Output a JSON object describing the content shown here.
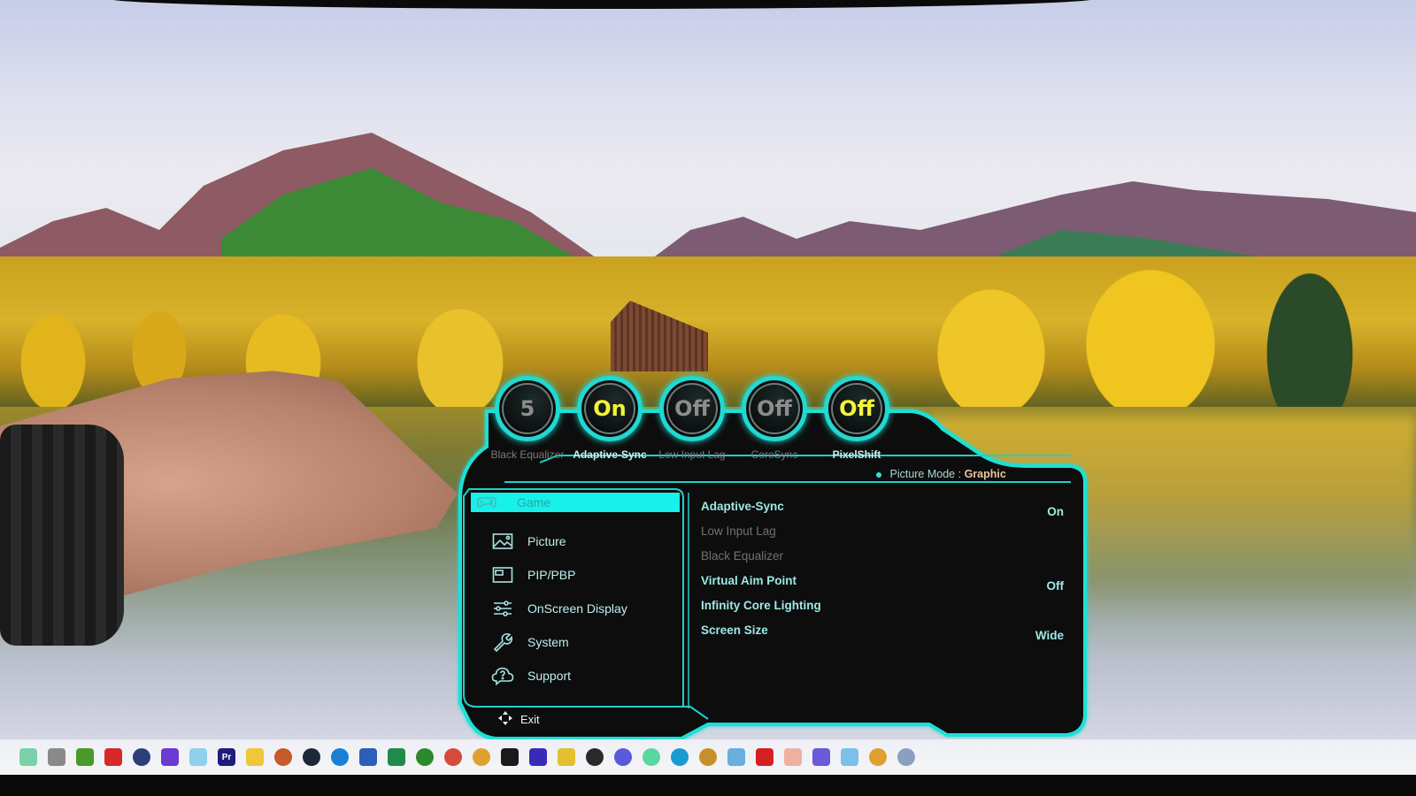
{
  "osd": {
    "quick_settings": [
      {
        "label": "Black Equalizer",
        "value": "5",
        "active": false
      },
      {
        "label": "Adaptive-Sync",
        "value": "On",
        "active": true
      },
      {
        "label": "Low Input Lag",
        "value": "Off",
        "active": false
      },
      {
        "label": "CoreSync",
        "value": "Off",
        "active": false
      },
      {
        "label": "PixelShift",
        "value": "Off",
        "active": true
      }
    ],
    "picture_mode": {
      "label": "Picture Mode :",
      "value": "Graphic"
    },
    "menu": [
      {
        "label": "Game",
        "icon": "gamepad-icon",
        "selected": true
      },
      {
        "label": "Picture",
        "icon": "picture-icon",
        "selected": false
      },
      {
        "label": "PIP/PBP",
        "icon": "pip-icon",
        "selected": false
      },
      {
        "label": "OnScreen Display",
        "icon": "sliders-icon",
        "selected": false
      },
      {
        "label": "System",
        "icon": "wrench-icon",
        "selected": false
      },
      {
        "label": "Support",
        "icon": "help-cloud-icon",
        "selected": false
      }
    ],
    "settings": [
      {
        "name": "Adaptive-Sync",
        "value": "On",
        "enabled": true
      },
      {
        "name": "Low Input Lag",
        "value": "",
        "enabled": false
      },
      {
        "name": "Black Equalizer",
        "value": "",
        "enabled": false
      },
      {
        "name": "Virtual Aim Point",
        "value": "Off",
        "enabled": true
      },
      {
        "name": "Infinity Core Lighting",
        "value": "",
        "enabled": true
      },
      {
        "name": "Screen Size",
        "value": "Wide",
        "enabled": true
      }
    ],
    "exit_label": "Exit",
    "colors": {
      "accent": "#1fe0d8",
      "active_value": "#f4f43a",
      "picture_mode_value": "#e8c79a"
    }
  },
  "taskbar": {
    "icons": [
      {
        "name": "widgets-icon",
        "color": "#7ad1a8"
      },
      {
        "name": "file-explorer-mini-icon",
        "color": "#8a8a8a"
      },
      {
        "name": "nvidia-icon",
        "color": "#4a9a2a"
      },
      {
        "name": "red-app-icon",
        "color": "#d62a2a"
      },
      {
        "name": "cinema4d-icon",
        "color": "#2b3f78"
      },
      {
        "name": "purple-app-icon",
        "color": "#6a3ad1"
      },
      {
        "name": "blue-doc-icon",
        "color": "#8fd0ee"
      },
      {
        "name": "premiere-pro-icon",
        "color": "#1d1d7a",
        "text": "Pr"
      },
      {
        "name": "folder-icon",
        "color": "#f0c63a"
      },
      {
        "name": "davinci-icon",
        "color": "#c65a2a"
      },
      {
        "name": "steam-icon",
        "color": "#1b2838"
      },
      {
        "name": "media-player-icon",
        "color": "#1a80d6"
      },
      {
        "name": "word-icon",
        "color": "#2b5fb8"
      },
      {
        "name": "excel-icon",
        "color": "#1f8a4a"
      },
      {
        "name": "quickbooks-icon",
        "color": "#2c8a2c"
      },
      {
        "name": "red-swirl-icon",
        "color": "#d64a3a"
      },
      {
        "name": "chrome-icon",
        "color": "#e0a030"
      },
      {
        "name": "capcut-icon",
        "color": "#1a1a1a"
      },
      {
        "name": "hulu-app-icon",
        "color": "#3a2ab8"
      },
      {
        "name": "notes-icon",
        "color": "#e2c030"
      },
      {
        "name": "obs-icon",
        "color": "#2a2a2a"
      },
      {
        "name": "chat-bubble-icon",
        "color": "#5a5ad8"
      },
      {
        "name": "whatsapp-icon",
        "color": "#5ad6a0"
      },
      {
        "name": "edge-icon",
        "color": "#1a9ad0"
      },
      {
        "name": "wow-icon",
        "color": "#c8902a"
      },
      {
        "name": "tablet-icon",
        "color": "#6aaee0"
      },
      {
        "name": "acrobat-icon",
        "color": "#d42020"
      },
      {
        "name": "snipping-icon",
        "color": "#f0b0a0"
      },
      {
        "name": "teams-icon",
        "color": "#6a5ad8"
      },
      {
        "name": "notepad-icon",
        "color": "#7ac0e8"
      },
      {
        "name": "chrome-2-icon",
        "color": "#e0a030"
      },
      {
        "name": "settings-icon",
        "color": "#8aa0c0"
      }
    ]
  }
}
